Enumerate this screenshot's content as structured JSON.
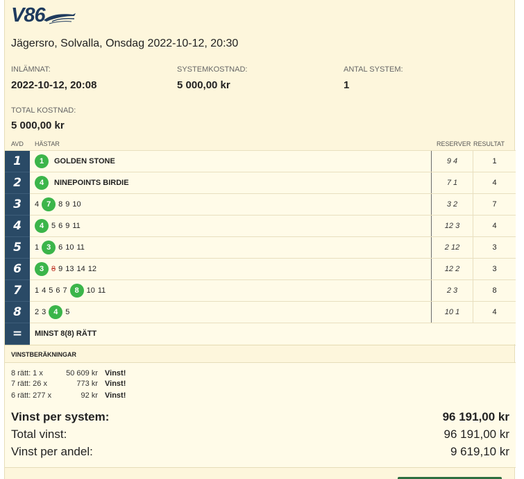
{
  "logo": {
    "text": "V86"
  },
  "race": {
    "title": "Jägersro, Solvalla, Onsdag 2022-10-12, 20:30"
  },
  "info": {
    "submitted_label": "INLÄMNAT:",
    "submitted_value": "2022-10-12, 20:08",
    "system_cost_label": "SYSTEMKOSTNAD:",
    "system_cost_value": "5 000,00 kr",
    "num_systems_label": "ANTAL SYSTEM:",
    "num_systems_value": "1",
    "total_cost_label": "TOTAL KOSTNAD:",
    "total_cost_value": "5 000,00 kr"
  },
  "columns": {
    "avd": "AVD",
    "hastar": "HÄSTAR",
    "reserver": "RESERVER",
    "resultat": "RESULTAT"
  },
  "legs": [
    {
      "num": "1",
      "horses": [
        {
          "n": "1",
          "win": true
        }
      ],
      "name": "GOLDEN STONE",
      "reserves": "9 4",
      "result": "1"
    },
    {
      "num": "2",
      "horses": [
        {
          "n": "4",
          "win": true
        }
      ],
      "name": "NINEPOINTS BIRDIE",
      "reserves": "7 1",
      "result": "4"
    },
    {
      "num": "3",
      "horses": [
        {
          "n": "4"
        },
        {
          "n": "7",
          "win": true
        },
        {
          "n": "8"
        },
        {
          "n": "9"
        },
        {
          "n": "10"
        }
      ],
      "reserves": "3 2",
      "result": "7"
    },
    {
      "num": "4",
      "horses": [
        {
          "n": "4",
          "win": true
        },
        {
          "n": "5"
        },
        {
          "n": "6"
        },
        {
          "n": "9"
        },
        {
          "n": "11"
        }
      ],
      "reserves": "12 3",
      "result": "4"
    },
    {
      "num": "5",
      "horses": [
        {
          "n": "1"
        },
        {
          "n": "3",
          "win": true
        },
        {
          "n": "6"
        },
        {
          "n": "10"
        },
        {
          "n": "11"
        }
      ],
      "reserves": "2 12",
      "result": "3"
    },
    {
      "num": "6",
      "horses": [
        {
          "n": "3",
          "win": true
        },
        {
          "n": "8",
          "scratched": true
        },
        {
          "n": "9"
        },
        {
          "n": "13"
        },
        {
          "n": "14"
        },
        {
          "n": "12"
        }
      ],
      "reserves": "12 2",
      "result": "3"
    },
    {
      "num": "7",
      "horses": [
        {
          "n": "1"
        },
        {
          "n": "4"
        },
        {
          "n": "5"
        },
        {
          "n": "6"
        },
        {
          "n": "7"
        },
        {
          "n": "8",
          "win": true
        },
        {
          "n": "10"
        },
        {
          "n": "11"
        }
      ],
      "reserves": "2 3",
      "result": "8"
    },
    {
      "num": "8",
      "horses": [
        {
          "n": "2"
        },
        {
          "n": "3"
        },
        {
          "n": "4",
          "win": true
        },
        {
          "n": "5"
        }
      ],
      "reserves": "10 1",
      "result": "4"
    }
  ],
  "minst_row": {
    "symbol": "=",
    "text": "MINST 8(8) RÄTT"
  },
  "vinst": {
    "header": "VINSTBERÄKNINGAR",
    "rows": [
      {
        "ratt": "8 rätt: 1 x",
        "amount": "50 609 kr",
        "status": "Vinst!"
      },
      {
        "ratt": "7 rätt: 26 x",
        "amount": "773 kr",
        "status": "Vinst!"
      },
      {
        "ratt": "6 rätt: 277 x",
        "amount": "92 kr",
        "status": "Vinst!"
      }
    ],
    "per_system_label": "Vinst per system:",
    "per_system_value": "96 191,00 kr",
    "total_label": "Total vinst:",
    "total_value": "96 191,00 kr",
    "per_share_label": "Vinst per andel:",
    "per_share_value": "9 619,10 kr"
  }
}
